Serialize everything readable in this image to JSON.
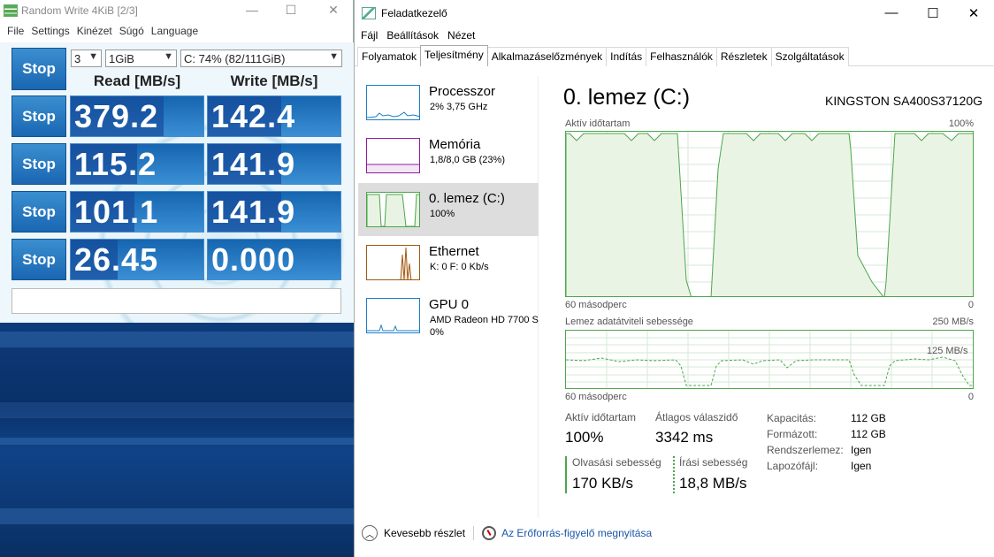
{
  "cdm": {
    "title": "Random Write 4KiB [2/3]",
    "menu": [
      "File",
      "Settings",
      "Kinézet",
      "Súgó",
      "Language"
    ],
    "stop_label": "Stop",
    "count": "3",
    "size": "1GiB",
    "drive": "C: 74% (82/111GiB)",
    "read_header": "Read [MB/s]",
    "write_header": "Write [MB/s]",
    "rows": [
      {
        "read": "379.2",
        "write": "142.4",
        "read_fill": 0.7,
        "write_fill": 0.55
      },
      {
        "read": "115.2",
        "write": "141.9",
        "read_fill": 0.5,
        "write_fill": 0.55
      },
      {
        "read": "101.1",
        "write": "141.9",
        "read_fill": 0.48,
        "write_fill": 0.55
      },
      {
        "read": "26.45",
        "write": "0.000",
        "read_fill": 0.35,
        "write_fill": 0
      }
    ]
  },
  "tm": {
    "title": "Feladatkezelő",
    "menu": [
      "Fájl",
      "Beállítások",
      "Nézet"
    ],
    "tabs": [
      "Folyamatok",
      "Teljesítmény",
      "Alkalmazáselőzmények",
      "Indítás",
      "Felhasználók",
      "Részletek",
      "Szolgáltatások"
    ],
    "active_tab": "Teljesítmény",
    "side": [
      {
        "name": "Processzor",
        "sub": "2% 3,75 GHz",
        "sub2": ""
      },
      {
        "name": "Memória",
        "sub": "1,8/8,0 GB (23%)",
        "sub2": ""
      },
      {
        "name": "0. lemez (C:)",
        "sub": "100%",
        "sub2": ""
      },
      {
        "name": "Ethernet",
        "sub": "K: 0 F: 0 Kb/s",
        "sub2": ""
      },
      {
        "name": "GPU 0",
        "sub": "AMD Radeon HD 7700 S",
        "sub2": "0%"
      }
    ],
    "heading": "0. lemez (C:)",
    "model": "KINGSTON SA400S37120G",
    "graph1_label": "Aktív időtartam",
    "graph1_max": "100%",
    "graph1_left": "60 másodperc",
    "graph1_right": "0",
    "graph2_label": "Lemez adatátviteli sebessége",
    "graph2_max": "250 MB/s",
    "graph2_mid": "125 MB/s",
    "graph2_left": "60 másodperc",
    "graph2_right": "0",
    "stats": {
      "active_label": "Aktív időtartam",
      "active_value": "100%",
      "resp_label": "Átlagos válaszidő",
      "resp_value": "3342 ms",
      "read_label": "Olvasási sebesség",
      "read_value": "170 KB/s",
      "write_label": "Írási sebesség",
      "write_value": "18,8 MB/s"
    },
    "info": [
      {
        "k": "Kapacitás:",
        "v": "112 GB"
      },
      {
        "k": "Formázott:",
        "v": "112 GB"
      },
      {
        "k": "Rendszerlemez:",
        "v": "Igen"
      },
      {
        "k": "Lapozófájl:",
        "v": "Igen"
      }
    ],
    "footer_less": "Kevesebb részlet",
    "footer_link": "Az Erőforrás-figyelő megnyitása"
  }
}
